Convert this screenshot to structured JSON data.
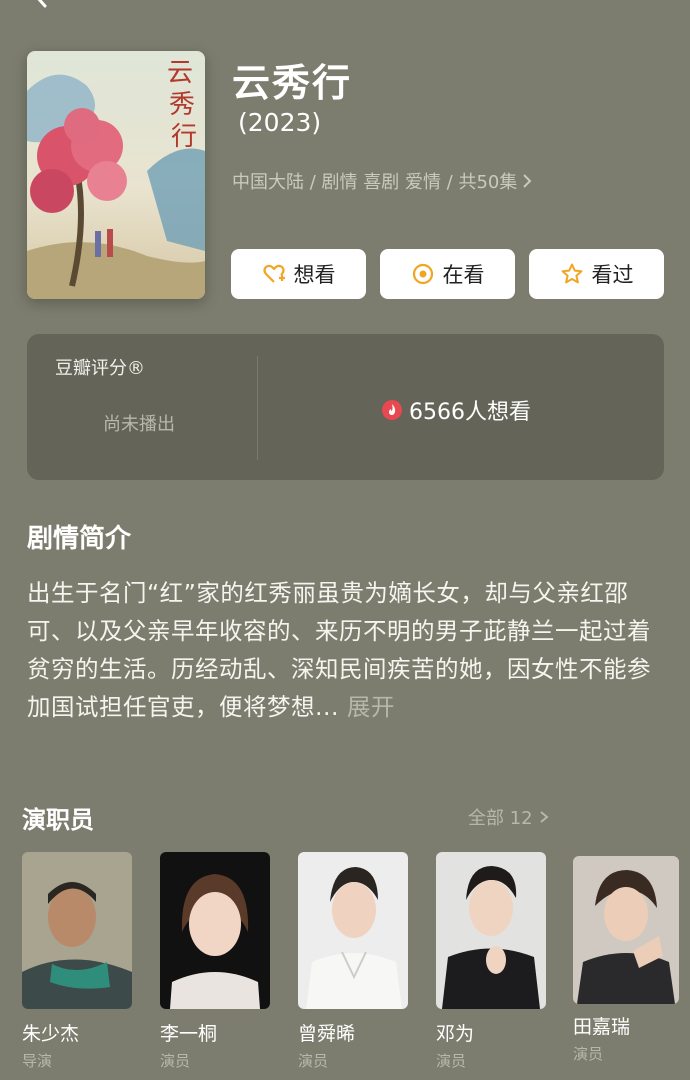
{
  "header": {
    "title": "云秀行",
    "year": "(2023)",
    "meta": "中国大陆 / 剧情 喜剧 爱情 / 共50集",
    "buttons": {
      "want": "想看",
      "watching": "在看",
      "watched": "看过"
    }
  },
  "rating": {
    "label": "豆瓣评分®",
    "status": "尚未播出",
    "want_count": "6566人想看"
  },
  "synopsis": {
    "title": "剧情简介",
    "text": "出生于名门“红”家的红秀丽虽贵为嫡长女，却与父亲红邵可、以及父亲早年收容的、来历不明的男子茈静兰一起过着贫穷的生活。历经动乱、深知民间疾苦的她，因女性不能参加国试担任官吏，便将梦想...",
    "expand": "展开"
  },
  "cast": {
    "title": "演职员",
    "all_label": "全部 12",
    "members": [
      {
        "name": "朱少杰",
        "role": "导演"
      },
      {
        "name": "李一桐",
        "role": "演员"
      },
      {
        "name": "曾舜晞",
        "role": "演员"
      },
      {
        "name": "邓为",
        "role": "演员"
      },
      {
        "name": "田嘉瑞",
        "role": "演员"
      }
    ]
  },
  "colors": {
    "background": "#7c7d6e",
    "card": "#646558",
    "accent": "#f0a623",
    "fire": "#e8484f"
  }
}
